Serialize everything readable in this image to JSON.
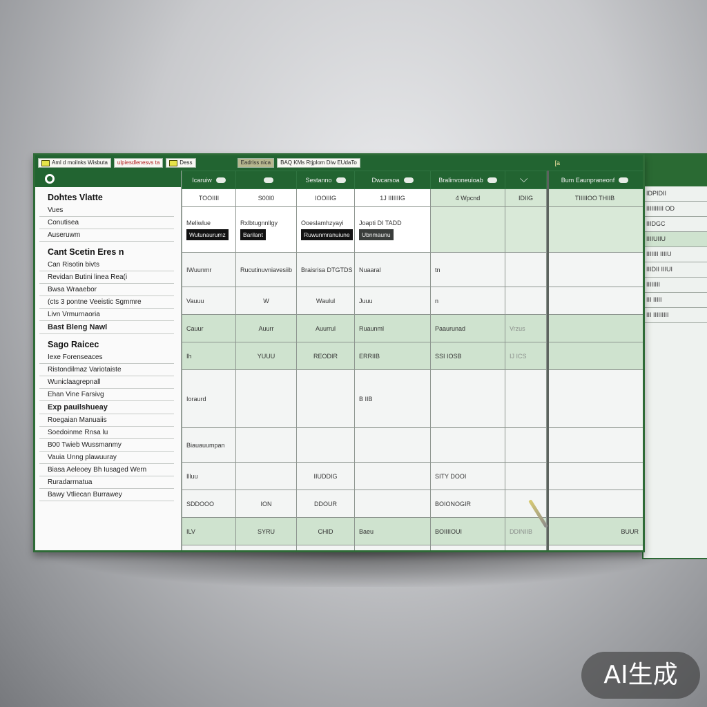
{
  "titlebar": {
    "chips": [
      "Aml d moilnks Wisbuta",
      "ulpiesdlenesvs ta",
      "Dess",
      "Eadriss nica",
      "BAQ KMs Rtjplom Diw EUdaTo"
    ],
    "right_text": "[a"
  },
  "left_pane": {
    "title": "Dohtes Vlatte",
    "items": [
      {
        "text": "Vues",
        "style": "normal"
      },
      {
        "text": "Conutisea",
        "style": "normal"
      },
      {
        "text": "Auseruwm",
        "style": "normal"
      },
      {
        "text": "Cant Scetin Eres n",
        "style": "heading"
      },
      {
        "text": "Can Risotin bivts",
        "style": "normal"
      },
      {
        "text": "Revidan Butini linea Rea(i",
        "style": "normal"
      },
      {
        "text": "Bwsa Wraaebor",
        "style": "normal"
      },
      {
        "text": "(cts 3   pontne Veeistic Sgmmre",
        "style": "normal"
      },
      {
        "text": "Livn   Vrmurnaoria",
        "style": "normal"
      },
      {
        "text": "Bast  Bleng  Nawl",
        "style": "bold"
      },
      {
        "text": "Sago Raicec",
        "style": "heading"
      },
      {
        "text": "Iexe Forenseaces",
        "style": "normal"
      },
      {
        "text": "Ristondilmaz Variotaiste",
        "style": "normal"
      },
      {
        "text": "Wuniclaagrepnall",
        "style": "normal"
      },
      {
        "text": "Ehan Vine Farsivg",
        "style": "normal"
      },
      {
        "text": "Exp pauilshueay",
        "style": "bold"
      },
      {
        "text": "Roegaian Manuaiis",
        "style": "normal"
      },
      {
        "text": "Soedoinme Rnsa lu",
        "style": "normal"
      },
      {
        "text": "B00  Twieb Wussmanmy",
        "style": "normal"
      },
      {
        "text": "Vauia Unng plawuuray",
        "style": "normal"
      },
      {
        "text": "Biasa Aeleoey  Bh Iusaged Wern",
        "style": "normal"
      },
      {
        "text": "Ruradarrnatua",
        "style": "normal"
      },
      {
        "text": "Bawy  Vtliecan Burrawey",
        "style": "normal"
      }
    ]
  },
  "grid": {
    "headers": [
      "Icaruiw",
      "",
      "Sestanno",
      "Dwcarsoa",
      "Bralinvoneuioab",
      "",
      "Bum Eaunpraneonf"
    ],
    "subheaders": [
      "TOOIIII",
      "S00I0",
      "IOOIIIG",
      "1J IIIIIIIG",
      "4   Wpcnd",
      "IDIIG",
      "TIIIIIOO   THIIB"
    ],
    "button_row": [
      {
        "label": "Meliwlue",
        "bar": "Wutunaurumz"
      },
      {
        "label": "Rxlbtugnnllgy",
        "bar": "Barilant"
      },
      {
        "label": "Ooeslamhzyayi",
        "bar": "Ruwunmranuiune"
      },
      {
        "label": "Joapti DI TADD",
        "bar": "Ubnmaunu"
      },
      {
        "label": "",
        "bar": ""
      },
      {
        "label": "",
        "bar": ""
      },
      {
        "label": "",
        "bar": ""
      }
    ],
    "rows": [
      {
        "style": "light",
        "height": "mid",
        "cells": [
          "IWuunmr",
          "Rucutinuvniavesiib",
          "Braisrisa DTGTDS",
          "Nuaaral",
          "tn",
          "",
          ""
        ]
      },
      {
        "style": "light",
        "height": "short",
        "cells": [
          "Vauuu",
          "W",
          "Waulul",
          "Juuu",
          "n",
          "",
          ""
        ]
      },
      {
        "style": "greenrow",
        "height": "short",
        "cells": [
          "Cauur",
          "Auurr",
          "Auurrul",
          "Ruaunml",
          "Paaurunad",
          "Vrzus",
          ""
        ]
      },
      {
        "style": "greenrow",
        "height": "short",
        "cells": [
          "Ih",
          "YUUU",
          "REODIR",
          "ERRIIB",
          "SSI IOSB",
          "IJ ICS",
          ""
        ]
      },
      {
        "style": "light",
        "height": "tall",
        "cells": [
          "Ioraurd",
          "",
          "",
          "B  IIB",
          "",
          "",
          ""
        ]
      },
      {
        "style": "light",
        "height": "mid",
        "cells": [
          "Biauauumpan",
          "",
          "",
          "",
          "",
          "",
          ""
        ]
      },
      {
        "style": "light",
        "height": "short",
        "cells": [
          "Illuu",
          "",
          "IIUDDIG",
          "",
          "SITY DOOI",
          "",
          ""
        ]
      },
      {
        "style": "light",
        "height": "short",
        "cells": [
          "SDDOOO",
          "ION",
          "DDOUR",
          "",
          "BOIONOGIR",
          "",
          ""
        ]
      },
      {
        "style": "greenrow",
        "height": "short",
        "cells": [
          "ILV",
          "SYRU",
          "CHID",
          "Baeu",
          "BOIIIIOUI",
          "DDINIIB",
          "BUUR"
        ]
      },
      {
        "style": "light",
        "height": "short",
        "cells": [
          "",
          "",
          "",
          "",
          "",
          "",
          ""
        ]
      }
    ]
  },
  "back_window": {
    "rows": [
      "IDPIDII",
      "IIIIIIIIII   OD",
      "IIIDGC",
      "IIIIUIIU",
      "IIIIIII  IIIIU",
      "IIIDII  IIIUI",
      "IIIIIIII",
      "III  IIIII",
      "III   IIIIIIIII"
    ]
  },
  "badge": {
    "text": "AI生成"
  }
}
